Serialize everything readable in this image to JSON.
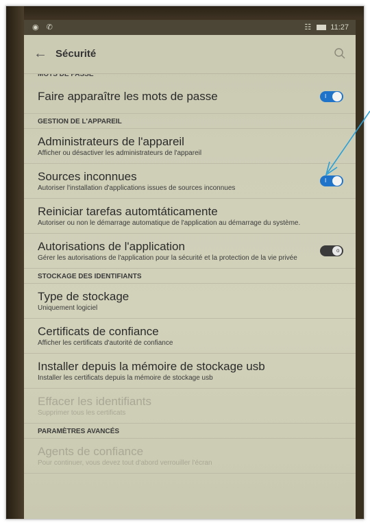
{
  "status": {
    "left_icons": "◉ ✆",
    "time": "11:27"
  },
  "appbar": {
    "title": "Sécurité"
  },
  "cut_header": "MOTS DE PASSE",
  "items": [
    {
      "title": "Faire apparaître les mots de passe",
      "subtitle": ""
    },
    {
      "title": "Administrateurs de l'appareil",
      "subtitle": "Afficher ou désactiver les administrateurs de l'appareil"
    },
    {
      "title": "Sources inconnues",
      "subtitle": "Autoriser l'installation d'applications issues de sources inconnues"
    },
    {
      "title": "Reiniciar tarefas automtáticamente",
      "subtitle": "Autoriser ou non le démarrage automatique de l'application au démarrage du système."
    },
    {
      "title": "Autorisations de l'application",
      "subtitle": "Gérer les autorisations de l'application pour la sécurité et la protection de la vie privée"
    },
    {
      "title": "Type de stockage",
      "subtitle": "Uniquement logiciel"
    },
    {
      "title": "Certificats de confiance",
      "subtitle": "Afficher les certificats d'autorité de confiance"
    },
    {
      "title": "Installer depuis la mémoire de stockage usb",
      "subtitle": "Installer les certificats depuis la mémoire de stockage usb"
    },
    {
      "title": "Effacer les identifiants",
      "subtitle": "Supprimer tous les certificats"
    },
    {
      "title": "Agents de confiance",
      "subtitle": "Pour continuer, vous devez tout d'abord verrouiller l'écran"
    }
  ],
  "headers": {
    "device": "GESTION DE L'APPAREIL",
    "credentials": "STOCKAGE DES IDENTIFIANTS",
    "advanced": "PARAMÈTRES AVANCÉS"
  },
  "toggles": {
    "show_passwords": true,
    "unknown_sources": true,
    "app_permissions": false
  },
  "colors": {
    "toggle_on": "#1f73c9",
    "arrow": "#2a9fd6"
  }
}
